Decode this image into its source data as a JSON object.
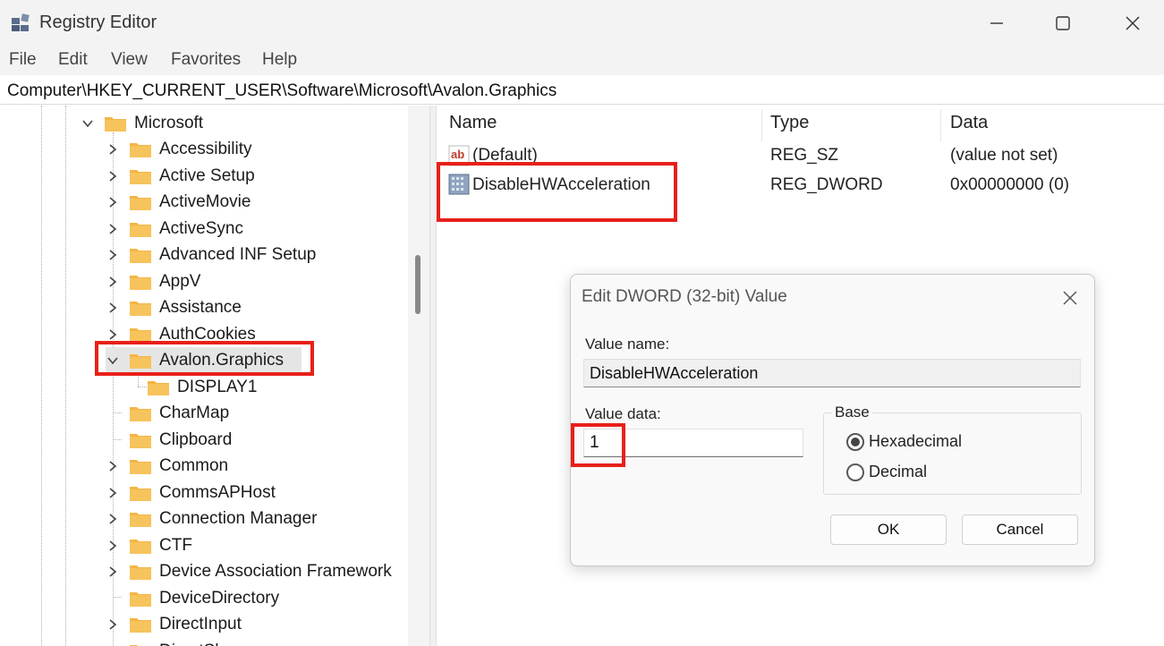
{
  "window": {
    "title": "Registry Editor",
    "icon": "registry-icon"
  },
  "menu": [
    "File",
    "Edit",
    "View",
    "Favorites",
    "Help"
  ],
  "address": "Computer\\HKEY_CURRENT_USER\\Software\\Microsoft\\Avalon.Graphics",
  "tree": {
    "parent": {
      "label": "Microsoft",
      "expanded": true
    },
    "children": [
      {
        "label": "Accessibility",
        "expandable": true
      },
      {
        "label": "Active Setup",
        "expandable": true
      },
      {
        "label": "ActiveMovie",
        "expandable": true
      },
      {
        "label": "ActiveSync",
        "expandable": true
      },
      {
        "label": "Advanced INF Setup",
        "expandable": true
      },
      {
        "label": "AppV",
        "expandable": true
      },
      {
        "label": "Assistance",
        "expandable": true
      },
      {
        "label": "AuthCookies",
        "expandable": true
      },
      {
        "label": "Avalon.Graphics",
        "expandable": true,
        "expanded": true,
        "selected": true
      },
      {
        "label": "DISPLAY1",
        "expandable": false,
        "child": true
      },
      {
        "label": "CharMap",
        "expandable": false
      },
      {
        "label": "Clipboard",
        "expandable": false
      },
      {
        "label": "Common",
        "expandable": true
      },
      {
        "label": "CommsAPHost",
        "expandable": true
      },
      {
        "label": "Connection Manager",
        "expandable": true
      },
      {
        "label": "CTF",
        "expandable": true
      },
      {
        "label": "Device Association Framework",
        "expandable": true
      },
      {
        "label": "DeviceDirectory",
        "expandable": false
      },
      {
        "label": "DirectInput",
        "expandable": true
      },
      {
        "label": "DirectSh...",
        "expandable": true
      }
    ]
  },
  "list": {
    "columns": [
      "Name",
      "Type",
      "Data"
    ],
    "rows": [
      {
        "name": "(Default)",
        "type": "REG_SZ",
        "data": "(value not set)",
        "icon": "string-value-icon"
      },
      {
        "name": "DisableHWAcceleration",
        "type": "REG_DWORD",
        "data": "0x00000000 (0)",
        "icon": "dword-value-icon"
      }
    ]
  },
  "dialog": {
    "title": "Edit DWORD (32-bit) Value",
    "value_name_label": "Value name:",
    "value_name": "DisableHWAcceleration",
    "value_data_label": "Value data:",
    "value_data": "1",
    "base_label": "Base",
    "base_options": [
      "Hexadecimal",
      "Decimal"
    ],
    "base_selected": "Hexadecimal",
    "ok_label": "OK",
    "cancel_label": "Cancel"
  },
  "colors": {
    "highlight": "#e8201a",
    "folder": "#f4b545",
    "selection": "#e5e5e5"
  }
}
